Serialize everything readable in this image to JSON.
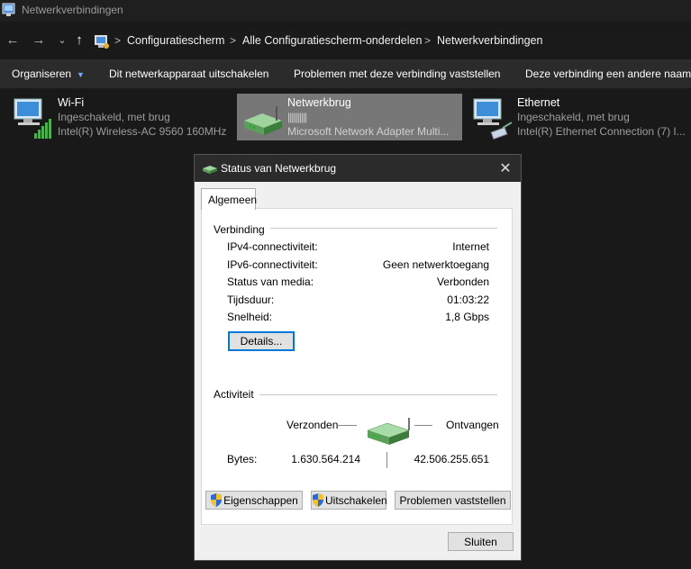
{
  "window": {
    "title": "Netwerkverbindingen"
  },
  "address": {
    "crumbs": [
      "Configuratiescherm",
      "Alle Configuratiescherm-onderdelen",
      "Netwerkverbindingen"
    ],
    "separator": ">"
  },
  "nav": {
    "back": "←",
    "forward": "→",
    "recent": "⌄",
    "up": "↑"
  },
  "toolbar": {
    "organize": "Organiseren",
    "disable": "Dit netwerkapparaat uitschakelen",
    "diagnose": "Problemen met deze verbinding vaststellen",
    "rename": "Deze verbinding een andere naam g"
  },
  "connections": [
    {
      "name": "Wi-Fi",
      "status": "Ingeschakeld, met brug",
      "device": "Intel(R) Wireless-AC 9560 160MHz",
      "icon": "wifi-adapter-icon"
    },
    {
      "name": "Netwerkbrug",
      "status": "||||||||||",
      "device": "Microsoft Network Adapter Multi...",
      "icon": "network-bridge-icon"
    },
    {
      "name": "Ethernet",
      "status": "Ingeschakeld, met brug",
      "device": "Intel(R) Ethernet Connection (7) I...",
      "icon": "ethernet-adapter-icon"
    }
  ],
  "dialog": {
    "title": "Status van Netwerkbrug",
    "close": "✕",
    "tab": "Algemeen",
    "connection": {
      "label": "Verbinding",
      "rows": [
        {
          "label": "IPv4-connectiviteit:",
          "value": "Internet"
        },
        {
          "label": "IPv6-connectiviteit:",
          "value": "Geen netwerktoegang"
        },
        {
          "label": "Status van media:",
          "value": "Verbonden"
        },
        {
          "label": "Tijdsduur:",
          "value": "01:03:22"
        },
        {
          "label": "Snelheid:",
          "value": "1,8 Gbps"
        }
      ],
      "details_button": "Details..."
    },
    "activity": {
      "label": "Activiteit",
      "sent_label": "Verzonden",
      "received_label": "Ontvangen",
      "bytes_label": "Bytes:",
      "bytes_sent": "1.630.564.214",
      "bytes_received": "42.506.255.651"
    },
    "buttons": {
      "properties": "Eigenschappen",
      "disable": "Uitschakelen",
      "diagnose": "Problemen vaststellen",
      "close": "Sluiten"
    }
  },
  "colors": {
    "accent": "#0078d7",
    "selection": "#777777",
    "dialog_bg": "#f0f0f0"
  }
}
